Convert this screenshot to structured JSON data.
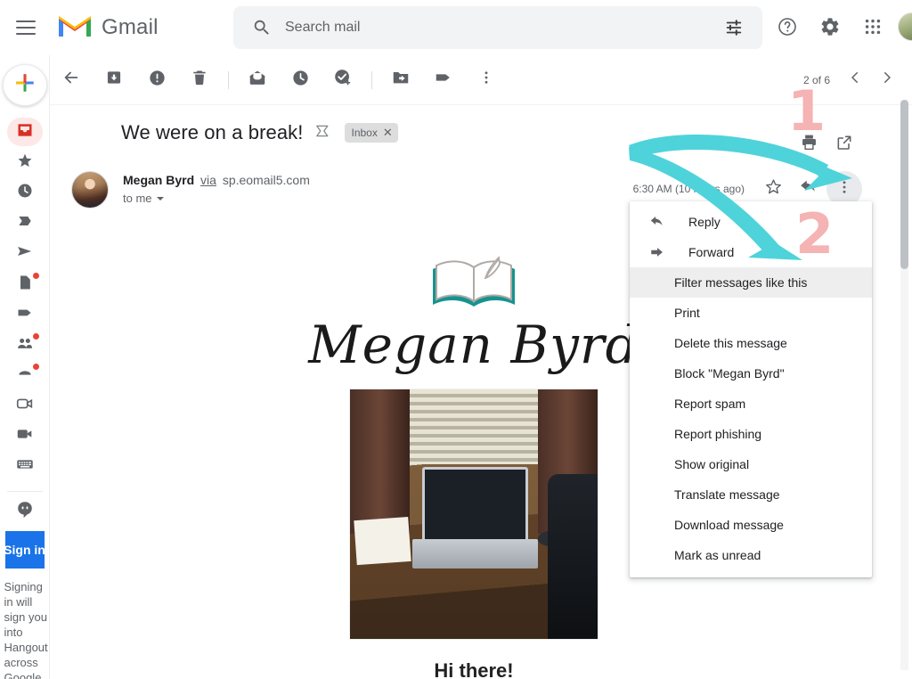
{
  "app": {
    "name": "Gmail",
    "menu_icon": "hamburger-menu-icon",
    "logo_icon": "gmail-logo-icon"
  },
  "search": {
    "placeholder": "Search mail",
    "value": "",
    "icon": "search-icon",
    "options_icon": "search-options-icon"
  },
  "header_right": {
    "support_label": "Support",
    "support_icon": "help-question-icon",
    "settings_icon": "gear-icon",
    "apps_icon": "google-apps-grid-icon",
    "account_icon": "account-avatar-icon"
  },
  "rail": {
    "compose_icon": "compose-plus-icon",
    "items": [
      {
        "name": "inbox",
        "icon": "inbox-icon",
        "active": true,
        "dot": false
      },
      {
        "name": "starred",
        "icon": "star-icon",
        "active": false,
        "dot": false
      },
      {
        "name": "snoozed",
        "icon": "clock-icon",
        "active": false,
        "dot": false
      },
      {
        "name": "important",
        "icon": "important-chevron-icon",
        "active": false,
        "dot": false
      },
      {
        "name": "sent",
        "icon": "send-paperplane-icon",
        "active": false,
        "dot": false
      },
      {
        "name": "drafts",
        "icon": "drafts-file-icon",
        "active": false,
        "dot": true
      },
      {
        "name": "categories",
        "icon": "label-tag-icon",
        "active": false,
        "dot": false
      },
      {
        "name": "contacts",
        "icon": "people-icon",
        "active": false,
        "dot": true
      },
      {
        "name": "chats",
        "icon": "chat-bubble-icon",
        "active": false,
        "dot": true
      },
      {
        "name": "meet-new",
        "icon": "video-outline-icon",
        "active": false,
        "dot": false
      },
      {
        "name": "meet-join",
        "icon": "video-filled-icon",
        "active": false,
        "dot": false
      },
      {
        "name": "keyboard",
        "icon": "keyboard-icon",
        "active": false,
        "dot": false
      }
    ],
    "hangouts": {
      "icon": "hangouts-quote-icon",
      "signin_label": "Sign in",
      "note": "Signing in will sign you into Hangouts across Google."
    }
  },
  "toolbar": {
    "buttons": [
      {
        "name": "back-to-inbox",
        "icon": "back-arrow-icon",
        "label": "Back to Inbox"
      },
      {
        "name": "archive",
        "icon": "archive-icon",
        "label": "Archive"
      },
      {
        "name": "report-spam",
        "icon": "report-spam-icon",
        "label": "Report spam"
      },
      {
        "name": "delete",
        "icon": "trash-icon",
        "label": "Delete"
      },
      {
        "name": "mark-as-unread",
        "icon": "mark-unread-envelope-icon",
        "label": "Mark as unread"
      },
      {
        "name": "snooze",
        "icon": "snooze-clock-icon",
        "label": "Snooze"
      },
      {
        "name": "add-to-tasks",
        "icon": "add-to-tasks-icon",
        "label": "Add to Tasks"
      },
      {
        "name": "move-to",
        "icon": "move-to-folder-icon",
        "label": "Move to"
      },
      {
        "name": "labels",
        "icon": "labels-tag-icon",
        "label": "Labels"
      },
      {
        "name": "more-options",
        "icon": "more-vertical-icon",
        "label": "More"
      }
    ],
    "pagination": {
      "label": "2 of 6",
      "newer_icon": "chevron-left-icon",
      "older_icon": "chevron-right-icon"
    }
  },
  "message": {
    "subject": "We were on a break!",
    "important_marker_icon": "important-marker-icon",
    "label_chip": {
      "text": "Inbox",
      "remove_icon": "close-x-icon"
    },
    "print_icon": "printer-icon",
    "popout_icon": "open-in-new-window-icon",
    "sender": {
      "name": "Megan Byrd",
      "via_word": "via",
      "via_domain": "sp.eomail5.com",
      "recipient": "to me",
      "recipient_caret_icon": "chevron-down-icon",
      "avatar_icon": "sender-avatar"
    },
    "timestamp": "6:30 AM (10 hours ago)",
    "star_icon": "star-outline-icon",
    "reply_icon": "reply-arrow-icon",
    "more_icon": "more-vertical-icon",
    "body": {
      "logo_icon": "open-book-quill-icon",
      "brand_script": "Megan Byrd",
      "photo_icon": "desk-laptop-window-photo",
      "greeting": "Hi there!"
    }
  },
  "dropdown_menu": {
    "items": [
      {
        "label": "Reply",
        "icon": "reply-arrow-icon",
        "highlight": false
      },
      {
        "label": "Forward",
        "icon": "forward-arrow-icon",
        "highlight": false
      },
      {
        "label": "Filter messages like this",
        "icon": "",
        "highlight": true
      },
      {
        "label": "Print",
        "icon": "",
        "highlight": false
      },
      {
        "label": "Delete this message",
        "icon": "",
        "highlight": false
      },
      {
        "label": "Block \"Megan Byrd\"",
        "icon": "",
        "highlight": false
      },
      {
        "label": "Report spam",
        "icon": "",
        "highlight": false
      },
      {
        "label": "Report phishing",
        "icon": "",
        "highlight": false
      },
      {
        "label": "Show original",
        "icon": "",
        "highlight": false
      },
      {
        "label": "Translate message",
        "icon": "",
        "highlight": false
      },
      {
        "label": "Download message",
        "icon": "",
        "highlight": false
      },
      {
        "label": "Mark as unread",
        "icon": "",
        "highlight": false
      }
    ]
  },
  "annotations": {
    "step_one": "1",
    "step_two": "2",
    "number_color": "#f5b3b3",
    "arrow_color": "#4fd3da"
  },
  "colors": {
    "gmail_red": "#ea4335",
    "accent_blue": "#1a73e8",
    "text_primary": "#202124",
    "text_secondary": "#5f6368",
    "menu_highlight": "#eeeeee",
    "logo_teal": "#1a8a8a"
  }
}
